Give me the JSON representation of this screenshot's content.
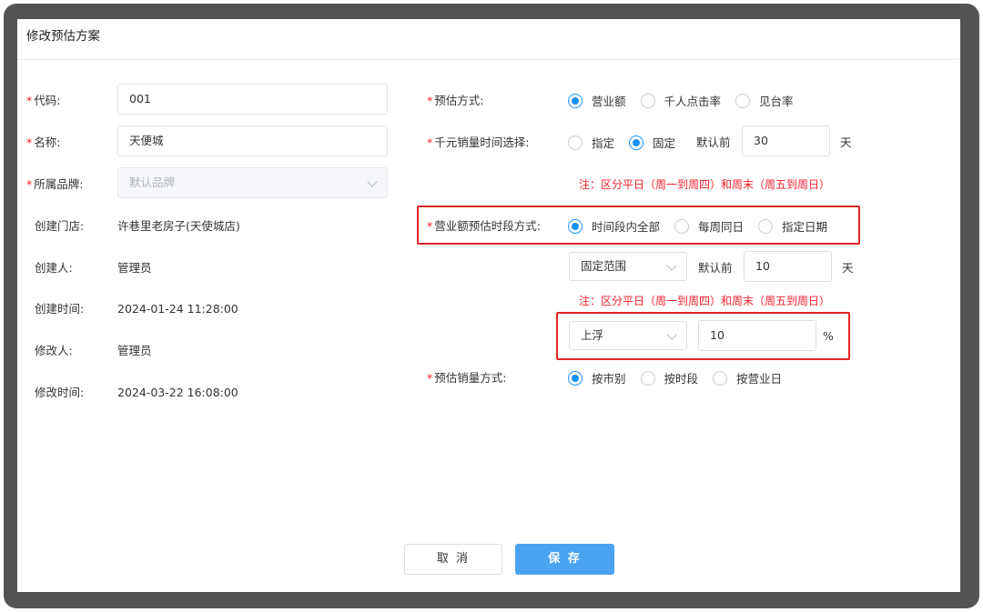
{
  "dialog": {
    "title": "修改预估方案"
  },
  "left": {
    "code": {
      "label": "代码:",
      "value": "001"
    },
    "name": {
      "label": "名称:",
      "value": "天便城"
    },
    "brand": {
      "label": "所属品牌:",
      "value": "默认品牌"
    },
    "store": {
      "label": "创建门店:",
      "value": "许巷里老房子(天使城店)"
    },
    "creator": {
      "label": "创建人:",
      "value": "管理员"
    },
    "created_at": {
      "label": "创建时间:",
      "value": "2024-01-24 11:28:00"
    },
    "modifier": {
      "label": "修改人:",
      "value": "管理员"
    },
    "modified_at": {
      "label": "修改时间:",
      "value": "2024-03-22 16:08:00"
    }
  },
  "right": {
    "method": {
      "label": "预估方式:",
      "options": [
        "营业额",
        "千人点击率",
        "见台率"
      ],
      "selected": 0
    },
    "sales_time": {
      "label": "千元销量时间选择:",
      "options": [
        "指定",
        "固定"
      ],
      "selected": 1,
      "default_prefix": "默认前",
      "default_value": "30",
      "unit": "天",
      "note": "注：区分平日（周一到周四）和周末（周五到周日）"
    },
    "revenue_period": {
      "label": "营业额预估时段方式:",
      "options": [
        "时间段内全部",
        "每周同日",
        "指定日期"
      ],
      "selected": 0,
      "range_select": "固定范围",
      "default_prefix": "默认前",
      "default_value": "10",
      "unit": "天",
      "note": "注：区分平日（周一到周四）和周末（周五到周日）"
    },
    "adjust": {
      "direction": "上浮",
      "value": "10",
      "unit": "%"
    },
    "sales_method": {
      "label": "预估销量方式:",
      "options": [
        "按市别",
        "按时段",
        "按营业日"
      ],
      "selected": 0
    }
  },
  "footer": {
    "cancel": "取 消",
    "save": "保 存"
  },
  "colors": {
    "primary": "#1890ff",
    "save_button": "#4aa3f0",
    "required": "#f5222d",
    "highlight": "#e02424",
    "frame": "#545457"
  }
}
